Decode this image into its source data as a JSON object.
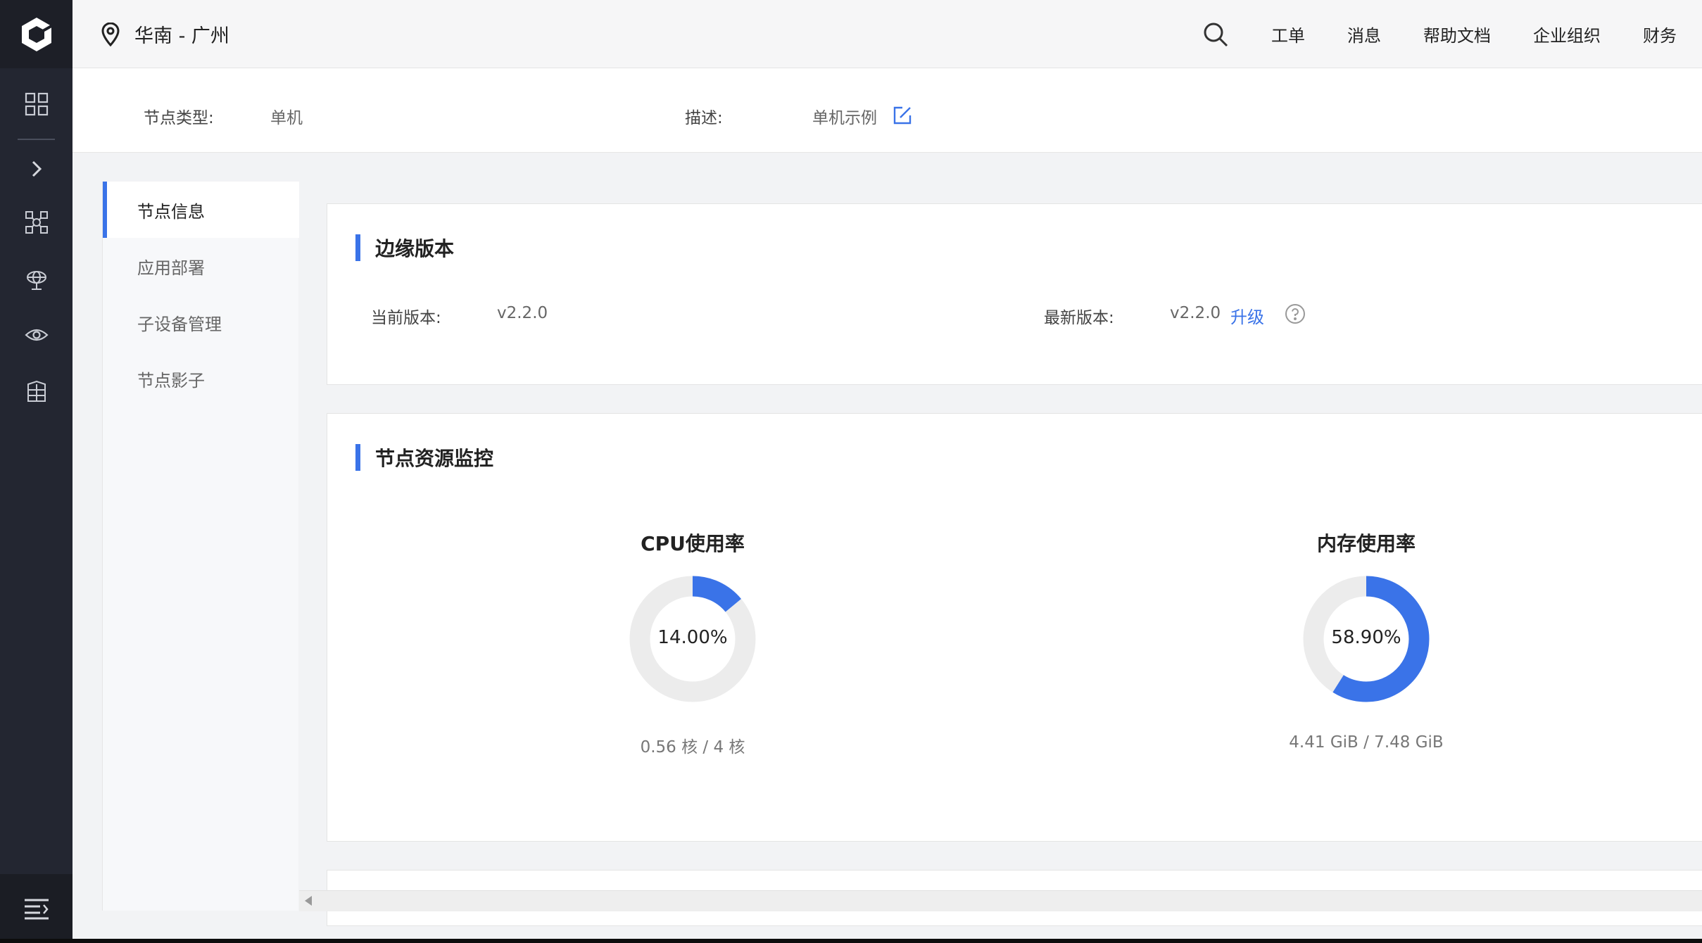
{
  "header": {
    "region": "华南 - 广州",
    "nav": [
      "工单",
      "消息",
      "帮助文档",
      "企业组织",
      "财务"
    ]
  },
  "sidebar": {
    "icons": [
      "logo-icon",
      "grid-icon",
      "expand-chevron-icon",
      "nodes-icon",
      "globe-icon",
      "eye-icon",
      "database-icon",
      "menu-collapse-icon"
    ]
  },
  "info": {
    "node_type_label": "节点类型:",
    "node_type_value": "单机",
    "desc_label": "描述:",
    "desc_value": "单机示例"
  },
  "submenu": {
    "items": [
      "节点信息",
      "应用部署",
      "子设备管理",
      "节点影子"
    ],
    "active_index": 0
  },
  "edge_version": {
    "title": "边缘版本",
    "current_label": "当前版本:",
    "current_value": "v2.2.0",
    "latest_label": "最新版本:",
    "latest_value": "v2.2.0",
    "upgrade_label": "升级"
  },
  "monitor": {
    "title": "节点资源监控",
    "cpu": {
      "title": "CPU使用率",
      "percent_text": "14.00%",
      "ratio": 0.14,
      "detail": "0.56 核 / 4 核"
    },
    "memory": {
      "title": "内存使用率",
      "percent_text": "58.90%",
      "ratio": 0.589,
      "detail": "4.41 GiB / 7.48 GiB"
    }
  },
  "colors": {
    "accent": "#3a73e8",
    "sidebar_bg": "#232631",
    "gauge_track": "#ececec"
  }
}
